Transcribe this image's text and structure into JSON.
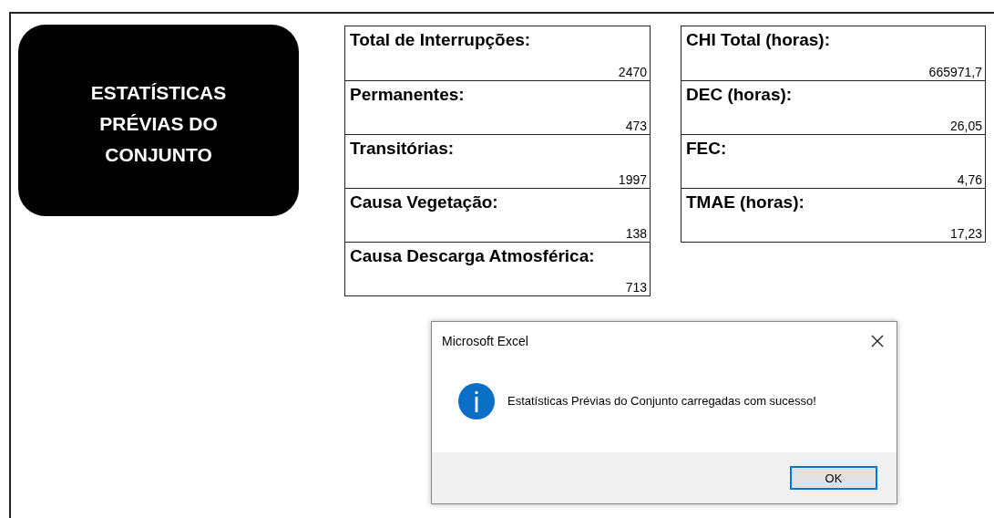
{
  "title_card": {
    "lines": [
      "ESTATÍSTICAS",
      "PRÉVIAS DO",
      "CONJUNTO"
    ]
  },
  "tables": [
    {
      "rows": [
        {
          "label": "Total de Interrupções:",
          "value": "2470"
        },
        {
          "label": "Permanentes:",
          "value": "473"
        },
        {
          "label": "Transitórias:",
          "value": "1997"
        },
        {
          "label": "Causa Vegetação:",
          "value": "138"
        },
        {
          "label": "Causa Descarga Atmosférica:",
          "value": "713"
        }
      ]
    },
    {
      "rows": [
        {
          "label": "CHI Total (horas):",
          "value": "665971,7"
        },
        {
          "label": "DEC (horas):",
          "value": "26,05"
        },
        {
          "label": "FEC:",
          "value": "4,76"
        },
        {
          "label": "TMAE (horas):",
          "value": "17,23"
        }
      ]
    }
  ],
  "dialog": {
    "title": "Microsoft Excel",
    "message": "Estatísticas Prévias do Conjunto carregadas com sucesso!",
    "buttons": [
      {
        "label": "OK",
        "selected": true
      }
    ]
  }
}
